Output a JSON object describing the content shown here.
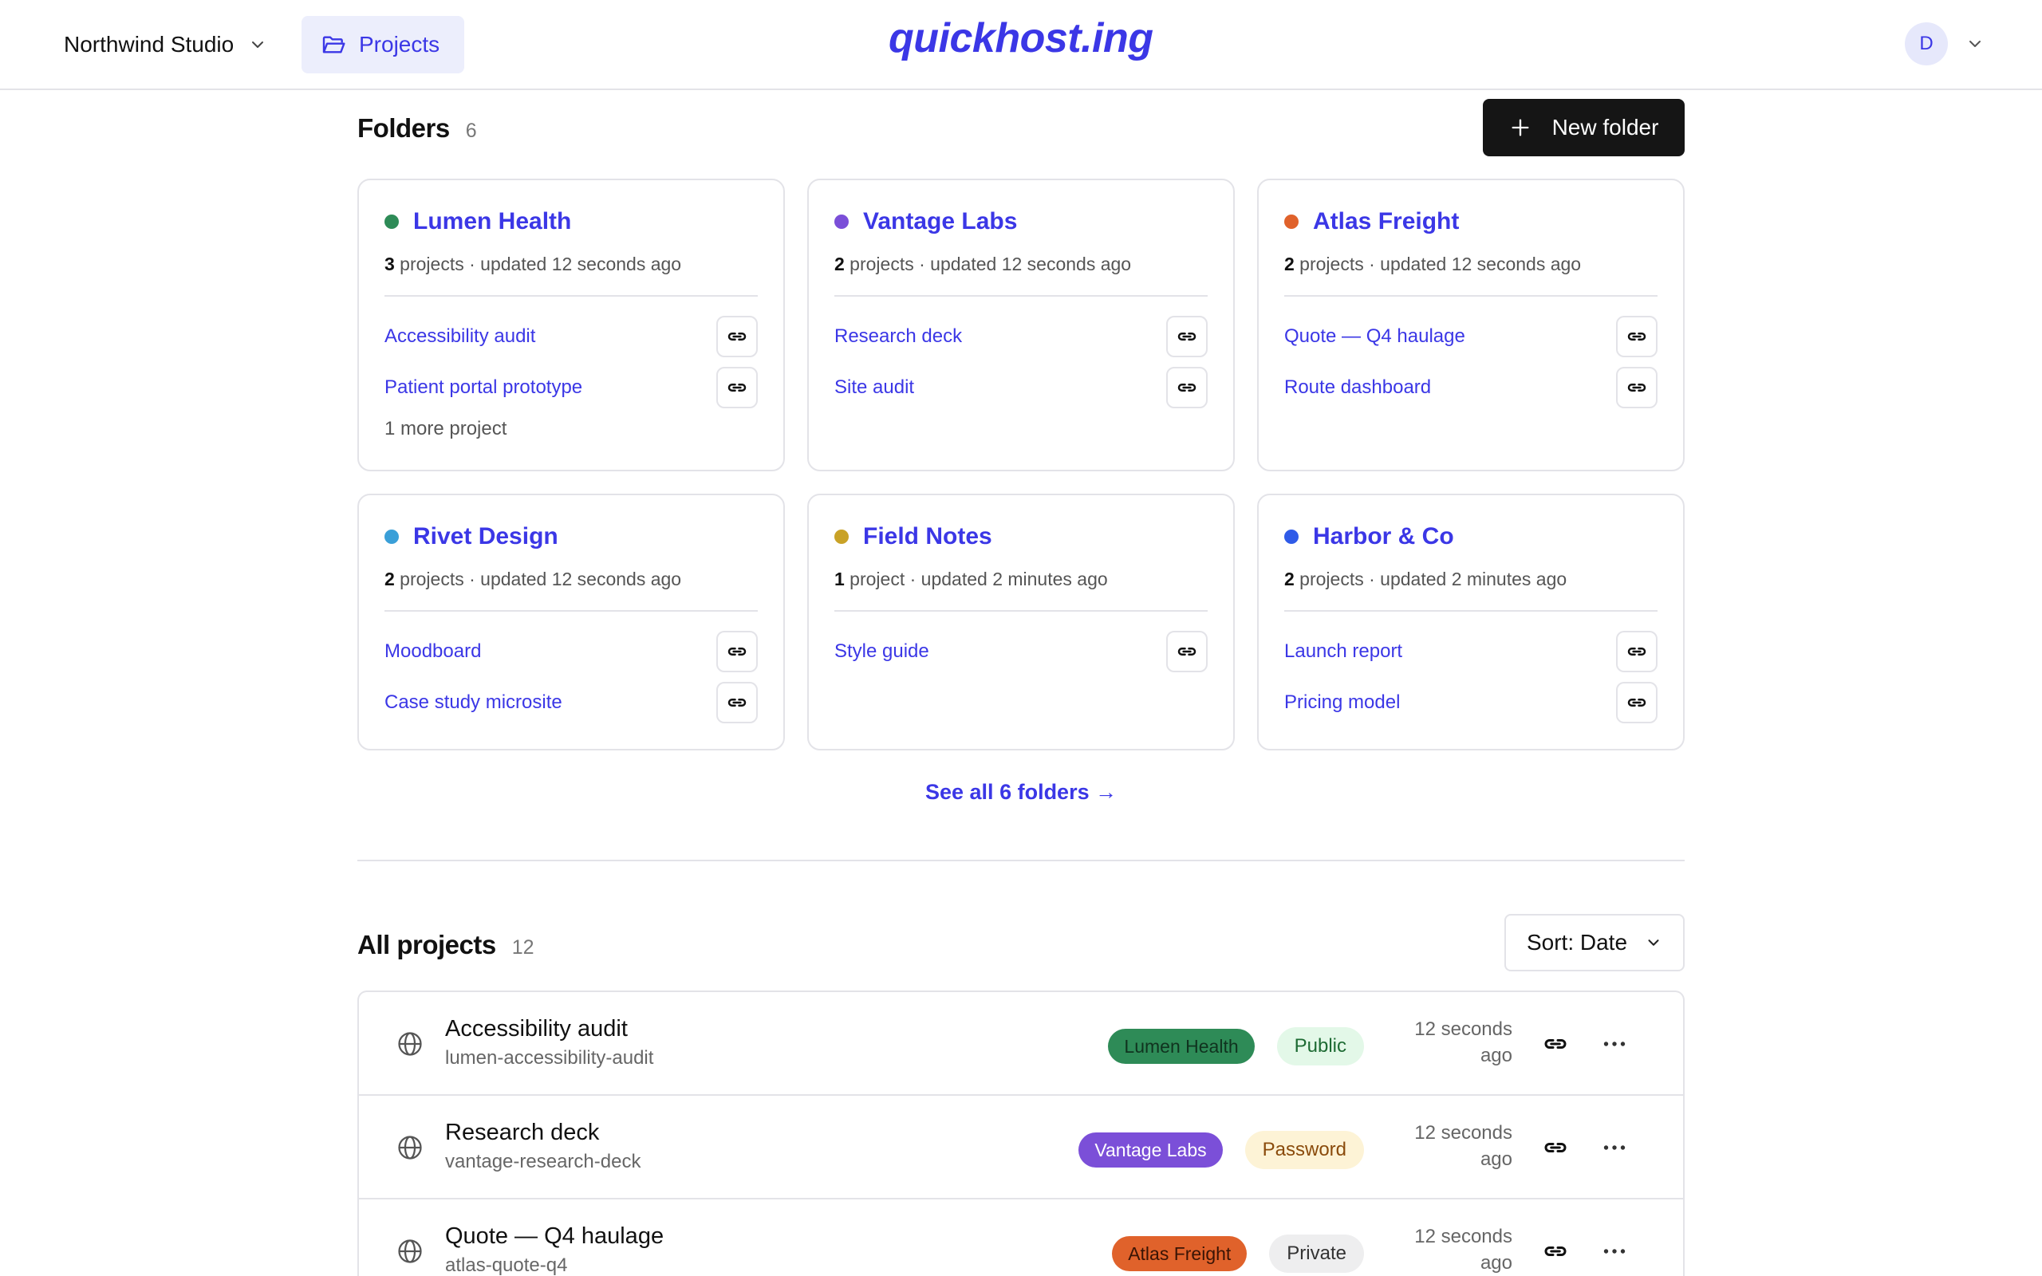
{
  "header": {
    "workspace": "Northwind Studio",
    "projects_tab": "Projects",
    "logo": "quickhost.ing",
    "avatar_initial": "D"
  },
  "folders": {
    "title": "Folders",
    "count": "6",
    "new_button": "New folder",
    "see_all": "See all 6 folders →",
    "items": [
      {
        "name": "Lumen Health",
        "color": "#2e8b57",
        "count": "3",
        "meta": "projects · updated 12 seconds ago",
        "links": [
          "Accessibility audit",
          "Patient portal prototype"
        ],
        "more": "1 more project"
      },
      {
        "name": "Vantage Labs",
        "color": "#7b4fd8",
        "count": "2",
        "meta": "projects · updated 12 seconds ago",
        "links": [
          "Research deck",
          "Site audit"
        ],
        "more": ""
      },
      {
        "name": "Atlas Freight",
        "color": "#e0622b",
        "count": "2",
        "meta": "projects · updated 12 seconds ago",
        "links": [
          "Quote — Q4 haulage",
          "Route dashboard"
        ],
        "more": ""
      },
      {
        "name": "Rivet Design",
        "color": "#3a9fd8",
        "count": "2",
        "meta": "projects · updated 12 seconds ago",
        "links": [
          "Moodboard",
          "Case study microsite"
        ],
        "more": ""
      },
      {
        "name": "Field Notes",
        "color": "#c9a227",
        "count": "1",
        "meta": "project · updated 2 minutes ago",
        "links": [
          "Style guide"
        ],
        "more": ""
      },
      {
        "name": "Harbor & Co",
        "color": "#2f5be8",
        "count": "2",
        "meta": "projects · updated 2 minutes ago",
        "links": [
          "Launch report",
          "Pricing model"
        ],
        "more": ""
      }
    ]
  },
  "projects": {
    "title": "All projects",
    "count": "12",
    "sort_label": "Sort: Date",
    "rows": [
      {
        "name": "Accessibility audit",
        "slug": "lumen-accessibility-audit",
        "folder": "Lumen Health",
        "folder_bg": "#2e8b57",
        "folder_fg": "#10331f",
        "visibility": "Public",
        "vis_bg": "#e3f8e8",
        "vis_fg": "#1d6b33",
        "time": "12 seconds ago"
      },
      {
        "name": "Research deck",
        "slug": "vantage-research-deck",
        "folder": "Vantage Labs",
        "folder_bg": "#7b4fd8",
        "folder_fg": "#ffffff",
        "visibility": "Password",
        "vis_bg": "#fdf3d6",
        "vis_fg": "#8a4b0c",
        "time": "12 seconds ago"
      },
      {
        "name": "Quote — Q4 haulage",
        "slug": "atlas-quote-q4",
        "folder": "Atlas Freight",
        "folder_bg": "#e0622b",
        "folder_fg": "#3a1405",
        "visibility": "Private",
        "vis_bg": "#eeeeef",
        "vis_fg": "#333333",
        "time": "12 seconds ago"
      }
    ]
  }
}
